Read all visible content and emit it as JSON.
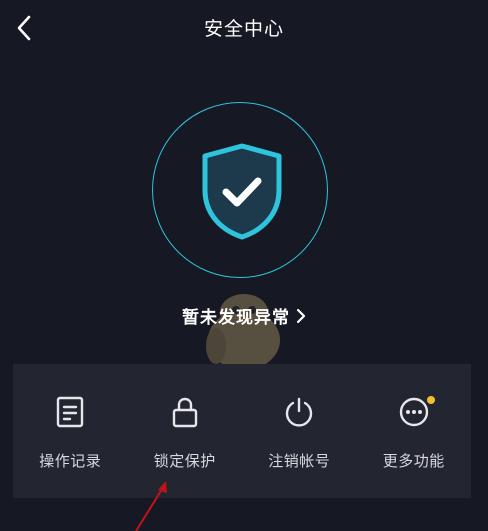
{
  "header": {
    "title": "安全中心",
    "back_icon": "chevron-left-icon"
  },
  "security": {
    "shield_icon": "shield-check-icon",
    "status_text": "暂未发现异常",
    "status_chevron": "›"
  },
  "functions": [
    {
      "label": "操作记录",
      "icon": "document-icon"
    },
    {
      "label": "锁定保护",
      "icon": "lock-icon"
    },
    {
      "label": "注销帐号",
      "icon": "power-icon"
    },
    {
      "label": "更多功能",
      "icon": "more-icon",
      "badge": true
    }
  ],
  "colors": {
    "background": "#161823",
    "panel": "#232530",
    "accent_cyan": "#2ec4dd",
    "badge_yellow": "#f2c12e",
    "annotation_red": "#c0141a"
  }
}
